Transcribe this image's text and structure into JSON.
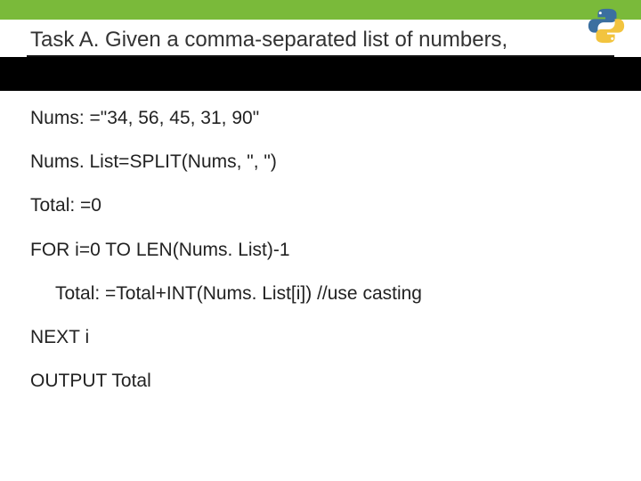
{
  "title": "Task A. Given a comma-separated list of numbers,",
  "code": {
    "l1": "Nums: =\"34, 56, 45, 31, 90\"",
    "l2": "Nums. List=SPLIT(Nums, \", \")",
    "l3": "Total: =0",
    "l4": "FOR i=0 TO LEN(Nums. List)-1",
    "l5": "Total: =Total+INT(Nums. List[i]) //use casting",
    "l6": "NEXT i",
    "l7": "OUTPUT Total"
  }
}
